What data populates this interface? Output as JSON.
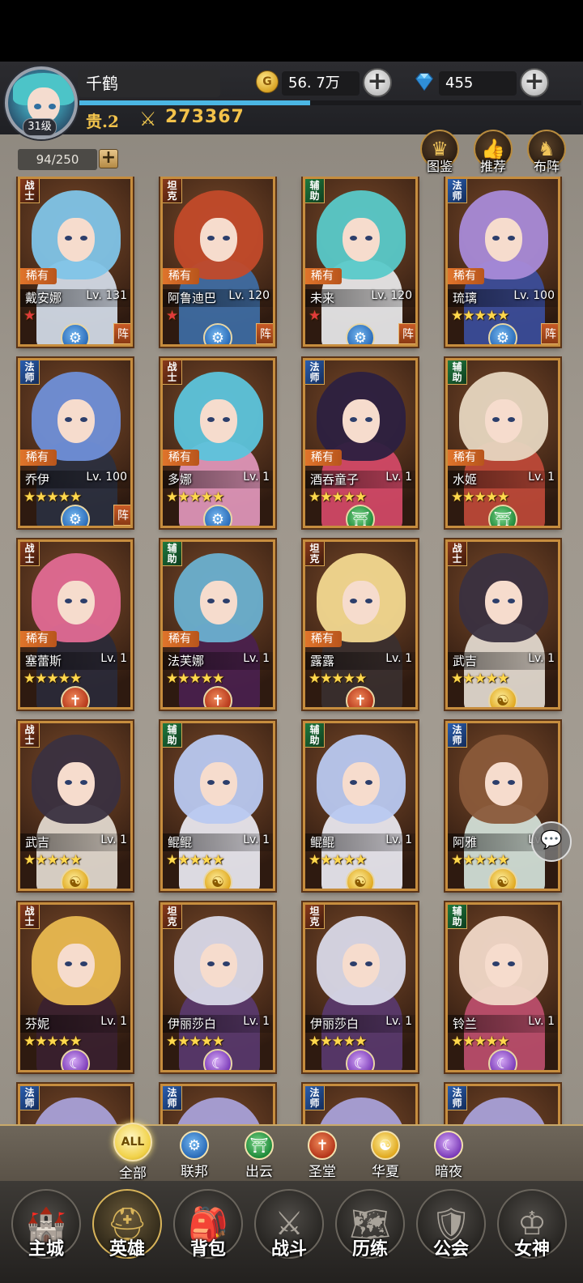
{
  "player": {
    "name": "千鹤",
    "level": "31级",
    "vip": "贵.2",
    "power": "273367",
    "exp_fraction": 0.46
  },
  "resources": {
    "gold": "56. 7万",
    "gems": "455"
  },
  "capacity": "94/250",
  "top_buttons": [
    "图鉴",
    "推荐",
    "布阵"
  ],
  "heroes": [
    {
      "role": "战士",
      "rarity": "稀有",
      "name": "戴安娜",
      "level": "Lv. 131",
      "stars": 1,
      "star_color": "red",
      "faction": "blue",
      "formation": "阵"
    },
    {
      "role": "坦克",
      "rarity": "稀有",
      "name": "阿鲁迪巴",
      "level": "Lv. 120",
      "stars": 1,
      "star_color": "red",
      "faction": "blue",
      "formation": "阵"
    },
    {
      "role": "辅助",
      "rarity": "稀有",
      "name": "未来",
      "level": "Lv. 120",
      "stars": 1,
      "star_color": "red",
      "faction": "blue",
      "formation": "阵"
    },
    {
      "role": "法师",
      "rarity": "稀有",
      "name": "琉璃",
      "level": "Lv. 100",
      "stars": 5,
      "star_color": "gold",
      "faction": "blue",
      "formation": "阵"
    },
    {
      "role": "法师",
      "rarity": "稀有",
      "name": "乔伊",
      "level": "Lv. 100",
      "stars": 5,
      "star_color": "gold",
      "faction": "blue",
      "formation": "阵"
    },
    {
      "role": "战士",
      "rarity": "稀有",
      "name": "多娜",
      "level": "Lv. 1",
      "stars": 5,
      "star_color": "gold",
      "faction": "blue",
      "formation": ""
    },
    {
      "role": "法师",
      "rarity": "稀有",
      "name": "酒吞童子",
      "level": "Lv. 1",
      "stars": 5,
      "star_color": "gold",
      "faction": "green",
      "formation": ""
    },
    {
      "role": "辅助",
      "rarity": "稀有",
      "name": "水姬",
      "level": "Lv. 1",
      "stars": 5,
      "star_color": "gold",
      "faction": "green",
      "formation": ""
    },
    {
      "role": "战士",
      "rarity": "稀有",
      "name": "塞蕾斯",
      "level": "Lv. 1",
      "stars": 5,
      "star_color": "gold",
      "faction": "red",
      "formation": ""
    },
    {
      "role": "辅助",
      "rarity": "稀有",
      "name": "法芙娜",
      "level": "Lv. 1",
      "stars": 5,
      "star_color": "gold",
      "faction": "red",
      "formation": ""
    },
    {
      "role": "坦克",
      "rarity": "稀有",
      "name": "露露",
      "level": "Lv. 1",
      "stars": 5,
      "star_color": "gold",
      "faction": "red",
      "formation": ""
    },
    {
      "role": "战士",
      "rarity": "",
      "name": "武吉",
      "level": "Lv. 1",
      "stars": 5,
      "star_color": "gold",
      "faction": "gold",
      "formation": ""
    },
    {
      "role": "战士",
      "rarity": "",
      "name": "武吉",
      "level": "Lv. 1",
      "stars": 5,
      "star_color": "gold",
      "faction": "gold",
      "formation": ""
    },
    {
      "role": "辅助",
      "rarity": "",
      "name": "鲲鲲",
      "level": "Lv. 1",
      "stars": 5,
      "star_color": "gold",
      "faction": "gold",
      "formation": ""
    },
    {
      "role": "辅助",
      "rarity": "",
      "name": "鲲鲲",
      "level": "Lv. 1",
      "stars": 5,
      "star_color": "gold",
      "faction": "gold",
      "formation": ""
    },
    {
      "role": "法师",
      "rarity": "",
      "name": "阿雅",
      "level": "Lv. 1",
      "stars": 5,
      "star_color": "gold",
      "faction": "gold",
      "formation": ""
    },
    {
      "role": "战士",
      "rarity": "",
      "name": "芬妮",
      "level": "Lv. 1",
      "stars": 5,
      "star_color": "gold",
      "faction": "purple",
      "formation": ""
    },
    {
      "role": "坦克",
      "rarity": "",
      "name": "伊丽莎白",
      "level": "Lv. 1",
      "stars": 5,
      "star_color": "gold",
      "faction": "purple",
      "formation": ""
    },
    {
      "role": "坦克",
      "rarity": "",
      "name": "伊丽莎白",
      "level": "Lv. 1",
      "stars": 5,
      "star_color": "gold",
      "faction": "purple",
      "formation": ""
    },
    {
      "role": "辅助",
      "rarity": "",
      "name": "铃兰",
      "level": "Lv. 1",
      "stars": 5,
      "star_color": "gold",
      "faction": "purple",
      "formation": ""
    },
    {
      "role": "法师",
      "rarity": "",
      "name": "",
      "level": "",
      "stars": 0,
      "star_color": "gold",
      "faction": "",
      "formation": ""
    },
    {
      "role": "法师",
      "rarity": "",
      "name": "",
      "level": "",
      "stars": 0,
      "star_color": "gold",
      "faction": "",
      "formation": ""
    },
    {
      "role": "法师",
      "rarity": "",
      "name": "",
      "level": "",
      "stars": 0,
      "star_color": "gold",
      "faction": "",
      "formation": ""
    },
    {
      "role": "法师",
      "rarity": "",
      "name": "",
      "level": "",
      "stars": 0,
      "star_color": "gold",
      "faction": "",
      "formation": ""
    }
  ],
  "filters": [
    {
      "label": "全部",
      "icon_text": "ALL",
      "color": "active"
    },
    {
      "label": "联邦",
      "icon_text": "⚙",
      "color": "blue"
    },
    {
      "label": "出云",
      "icon_text": "⛩",
      "color": "green"
    },
    {
      "label": "圣堂",
      "icon_text": "✝",
      "color": "red"
    },
    {
      "label": "华夏",
      "icon_text": "☯",
      "color": "gold"
    },
    {
      "label": "暗夜",
      "icon_text": "☾",
      "color": "purple"
    }
  ],
  "nav": [
    {
      "label": "主城",
      "icon": "castle-icon"
    },
    {
      "label": "英雄",
      "icon": "hero-icon",
      "active": true
    },
    {
      "label": "背包",
      "icon": "backpack-icon"
    },
    {
      "label": "战斗",
      "icon": "swords-icon"
    },
    {
      "label": "历练",
      "icon": "map-icon"
    },
    {
      "label": "公会",
      "icon": "shield-icon"
    },
    {
      "label": "女神",
      "icon": "goddess-icon"
    }
  ]
}
